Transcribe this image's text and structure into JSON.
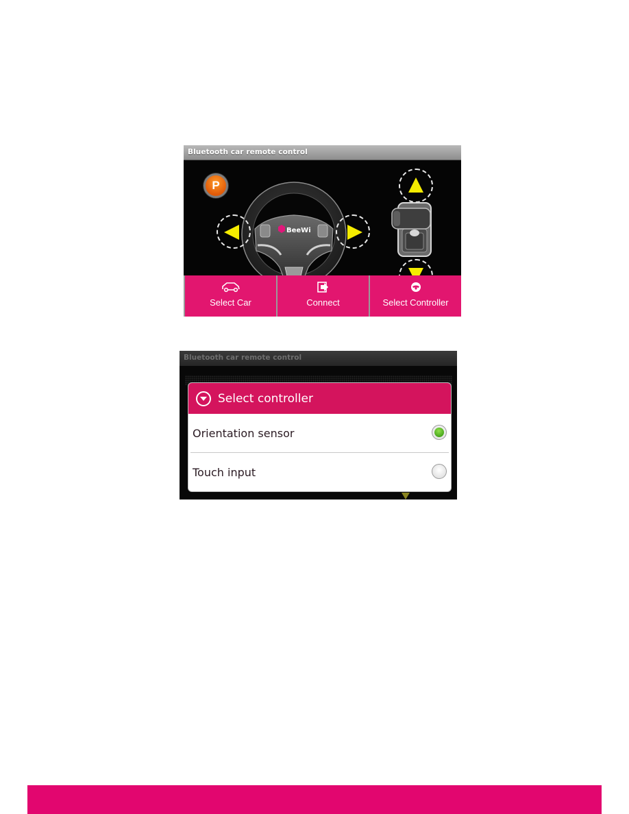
{
  "screen_main": {
    "title": "Bluetooth car remote control",
    "park_button": {
      "label": "P",
      "icon": "parking-icon",
      "color": "#f07818"
    },
    "steering_wheel": {
      "brand": "BeeWi",
      "icon": "steering-wheel-icon"
    },
    "direction_buttons": [
      {
        "name": "left",
        "icon": "triangle-left-icon"
      },
      {
        "name": "right",
        "icon": "triangle-right-icon"
      },
      {
        "name": "forward",
        "icon": "triangle-up-icon"
      },
      {
        "name": "backward",
        "icon": "triangle-down-icon"
      }
    ],
    "gear_shift": {
      "icon": "gear-shift-icon"
    },
    "action_bar": [
      {
        "label": "Select Car",
        "icon": "car-icon"
      },
      {
        "label": "Connect",
        "icon": "connect-icon"
      },
      {
        "label": "Select Controller",
        "icon": "steering-wheel-icon"
      }
    ],
    "accent_color": "#e2166f",
    "arrow_color": "#f5ec00"
  },
  "screen_dialog": {
    "title": "Bluetooth car remote control",
    "dialog": {
      "title": "Select controller",
      "icon": "dropdown-circle-icon",
      "options": [
        {
          "label": "Orientation sensor",
          "selected": true
        },
        {
          "label": "Touch input",
          "selected": false
        }
      ]
    },
    "header_color": "#d4145d"
  },
  "page": {
    "footer_color": "#e2066f"
  }
}
